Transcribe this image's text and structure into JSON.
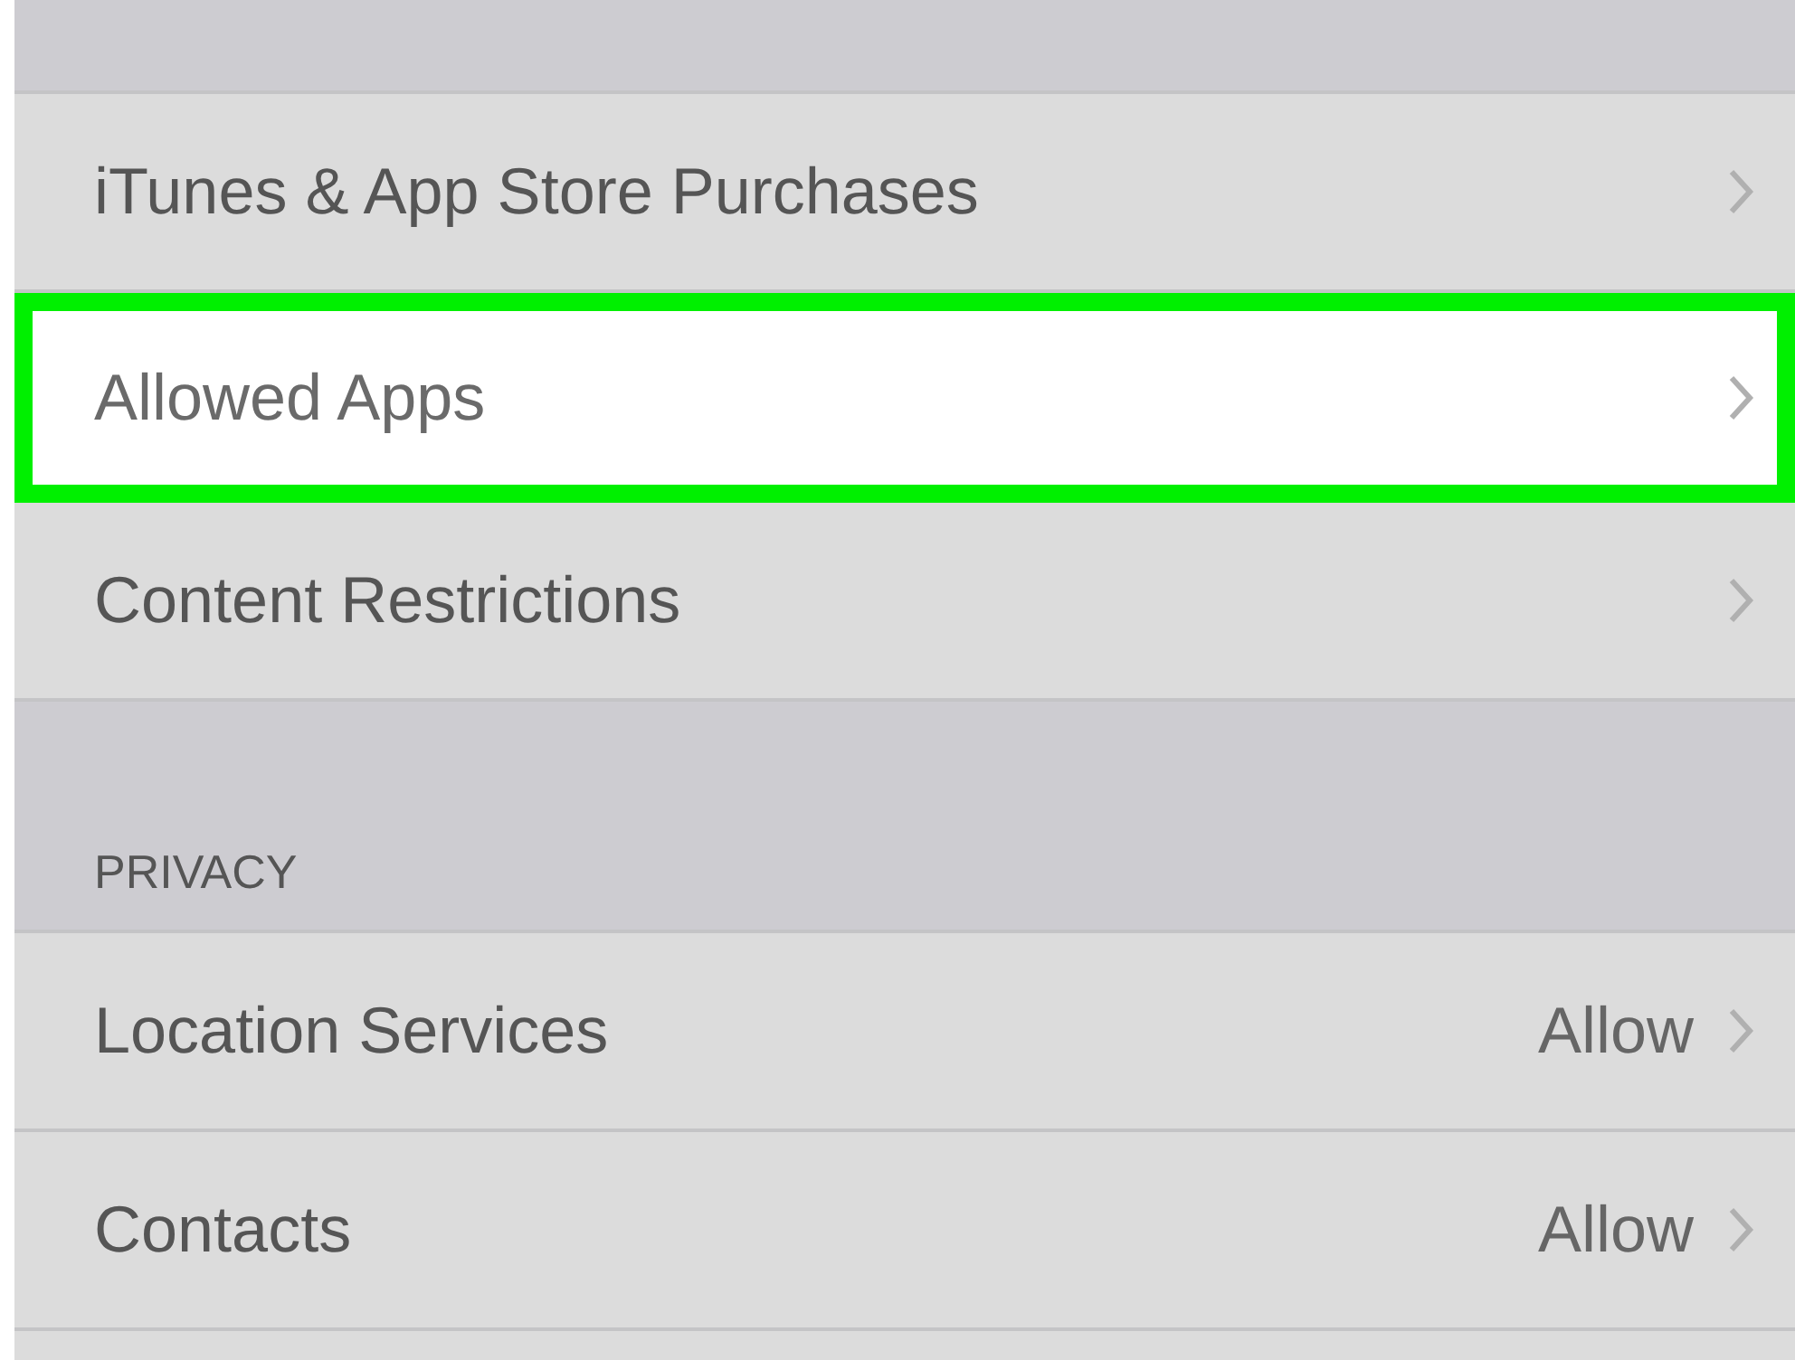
{
  "sections": [
    {
      "rows": [
        {
          "label": "iTunes & App Store Purchases",
          "highlighted": false
        },
        {
          "label": "Allowed Apps",
          "highlighted": true
        },
        {
          "label": "Content Restrictions",
          "highlighted": false
        }
      ]
    },
    {
      "header": "PRIVACY",
      "rows": [
        {
          "label": "Location Services",
          "value": "Allow",
          "highlighted": false
        },
        {
          "label": "Contacts",
          "value": "Allow",
          "highlighted": false
        }
      ]
    }
  ]
}
